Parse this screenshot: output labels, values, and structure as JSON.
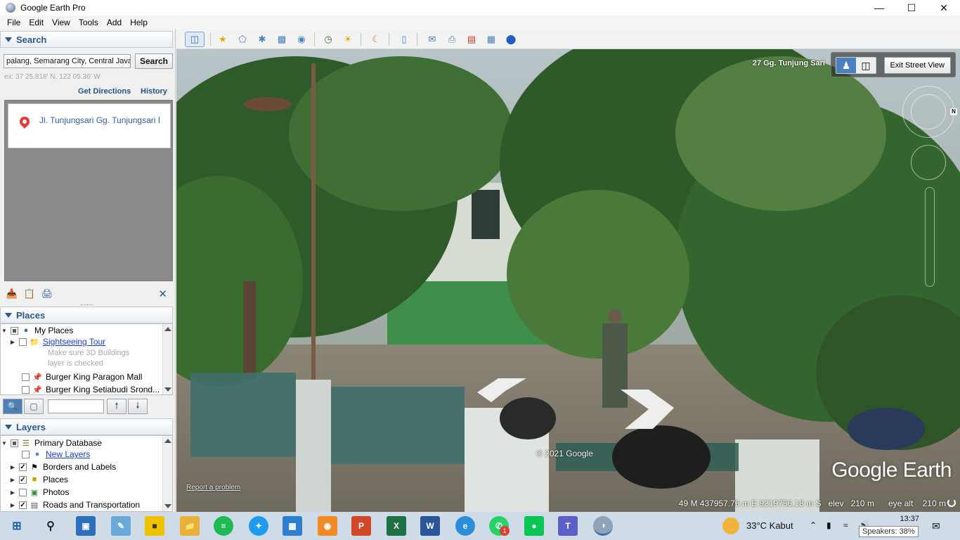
{
  "window": {
    "title": "Google Earth Pro"
  },
  "menu": [
    "File",
    "Edit",
    "View",
    "Tools",
    "Add",
    "Help"
  ],
  "search": {
    "header": "Search",
    "query": "palang, Semarang City, Central Java",
    "button": "Search",
    "coord_hint": "ex: 37 25.818' N, 122 05.36' W",
    "get_directions": "Get Directions",
    "history": "History",
    "result": "Jl. Tunjungsari Gg. Tunjungsari I"
  },
  "places": {
    "header": "Places",
    "root": "My Places",
    "sightseeing": "Sightseeing Tour",
    "hint_line1": "Make sure 3D Buildings",
    "hint_line2": "layer is checked",
    "item1": "Burger King Paragon Mall",
    "item2": "Burger King Setiabudi Srond..."
  },
  "layers": {
    "header": "Layers",
    "root": "Primary Database",
    "new_layers": "New Layers",
    "borders": "Borders and Labels",
    "places": "Places",
    "photos": "Photos",
    "roads": "Roads and Transportation"
  },
  "streetview": {
    "address": "27 Gg. Tunjung Sari",
    "exit": "Exit Street View",
    "copyright": "© 2021 Google",
    "report": "Report a problem",
    "logo": "Google Earth",
    "status": "49 M 437957.76 m E 9219756.18 m S   elev   210 m      eye alt    210 m"
  },
  "taskbar": {
    "weather": "33°C  Kabut",
    "time": "13:37",
    "tooltip": "Speakers: 38%",
    "whatsapp_badge": "1"
  },
  "colors": {
    "accent": "#2a5a8a",
    "link": "#1a3fd1",
    "result_link": "#2d5fa6"
  }
}
